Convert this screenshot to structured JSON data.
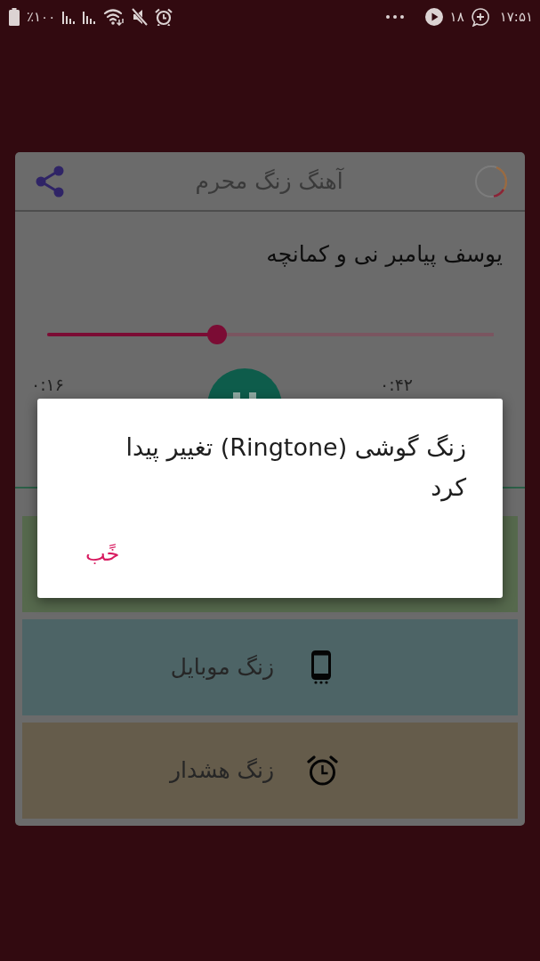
{
  "status_bar": {
    "battery_text": "٪۱۰۰",
    "notification_count": "۱۸",
    "time": "۱۷:۵۱"
  },
  "header": {
    "title": "آهنگ زنگ محرم"
  },
  "player": {
    "track_title": "یوسف پیامبر نی و کمانچه",
    "progress": {
      "level": 0.38
    },
    "elapsed": "۰:۱۶",
    "duration": "۰:۴۲",
    "playing": true
  },
  "actions": [
    {
      "kind": "blank",
      "color": "#56694d"
    },
    {
      "kind": "phone",
      "label": "زنگ موبایل",
      "color": "#4d6466"
    },
    {
      "kind": "alarm",
      "label": "زنگ هشدار",
      "color": "#655c4b"
    }
  ],
  "dialog": {
    "message": "زنگ گوشی (Ringtone) تغییر پیدا کرد",
    "button": "خًب"
  }
}
